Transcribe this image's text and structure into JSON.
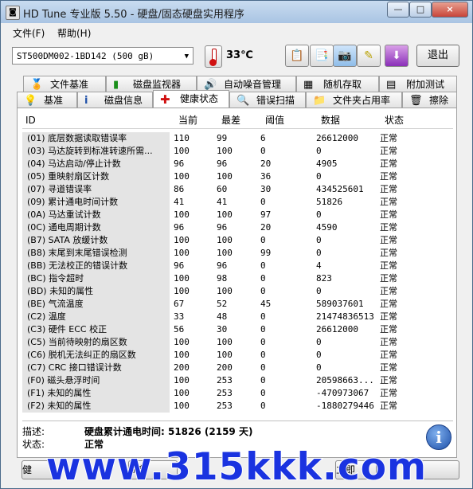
{
  "window": {
    "title": "HD Tune 专业版 5.50 - 硬盘/固态硬盘实用程序",
    "minimize": "—",
    "maximize": "□",
    "close": "×"
  },
  "menu": {
    "file": "文件(F)",
    "help": "帮助(H)"
  },
  "toolbar": {
    "drive": "ST500DM002-1BD142 (500 gB)",
    "temperature": "33℃",
    "exit": "退出",
    "icons": [
      "copy-icon",
      "copy-all-icon",
      "camera-icon",
      "settings-icon",
      "download-icon"
    ]
  },
  "tabs_top": [
    {
      "label": "文件基准",
      "icon": "file-benchmark-icon"
    },
    {
      "label": "磁盘监视器",
      "icon": "disk-monitor-icon"
    },
    {
      "label": "自动噪音管理",
      "icon": "speaker-icon"
    },
    {
      "label": "随机存取",
      "icon": "random-access-icon"
    },
    {
      "label": "附加测试",
      "icon": "extra-tests-icon"
    }
  ],
  "tabs_bottom": [
    {
      "label": "基准",
      "icon": "benchmark-icon"
    },
    {
      "label": "磁盘信息",
      "icon": "info-icon"
    },
    {
      "label": "健康状态",
      "icon": "health-cross-icon",
      "active": true
    },
    {
      "label": "错误扫描",
      "icon": "error-scan-icon"
    },
    {
      "label": "文件夹占用率",
      "icon": "folder-icon"
    },
    {
      "label": "擦除",
      "icon": "erase-icon"
    }
  ],
  "table": {
    "headers": [
      "ID",
      "当前",
      "最差",
      "阈值",
      "数据",
      "状态"
    ],
    "rows": [
      [
        "(01) 底层数据读取错误率",
        "110",
        "99",
        "6",
        "26612000",
        "正常"
      ],
      [
        "(03) 马达旋转到标准转速所需...",
        "100",
        "100",
        "0",
        "0",
        "正常"
      ],
      [
        "(04) 马达启动/停止计数",
        "96",
        "96",
        "20",
        "4905",
        "正常"
      ],
      [
        "(05) 重映射扇区计数",
        "100",
        "100",
        "36",
        "0",
        "正常"
      ],
      [
        "(07) 寻道错误率",
        "86",
        "60",
        "30",
        "434525601",
        "正常"
      ],
      [
        "(09) 累计通电时间计数",
        "41",
        "41",
        "0",
        "51826",
        "正常"
      ],
      [
        "(0A) 马达重试计数",
        "100",
        "100",
        "97",
        "0",
        "正常"
      ],
      [
        "(0C) 通电周期计数",
        "96",
        "96",
        "20",
        "4590",
        "正常"
      ],
      [
        "(B7) SATA 放缓计数",
        "100",
        "100",
        "0",
        "0",
        "正常"
      ],
      [
        "(B8) 末尾到末尾错误检测",
        "100",
        "100",
        "99",
        "0",
        "正常"
      ],
      [
        "(BB) 无法校正的错误计数",
        "96",
        "96",
        "0",
        "4",
        "正常"
      ],
      [
        "(BC) 指令超时",
        "100",
        "98",
        "0",
        "823",
        "正常"
      ],
      [
        "(BD) 未知的属性",
        "100",
        "100",
        "0",
        "0",
        "正常"
      ],
      [
        "(BE) 气流温度",
        "67",
        "52",
        "45",
        "589037601",
        "正常"
      ],
      [
        "(C2) 温度",
        "33",
        "48",
        "0",
        "21474836513",
        "正常"
      ],
      [
        "(C3) 硬件 ECC 校正",
        "56",
        "30",
        "0",
        "26612000",
        "正常"
      ],
      [
        "(C5) 当前待映射的扇区数",
        "100",
        "100",
        "0",
        "0",
        "正常"
      ],
      [
        "(C6) 脱机无法纠正的扇区数",
        "100",
        "100",
        "0",
        "0",
        "正常"
      ],
      [
        "(C7) CRC 接口错误计数",
        "200",
        "200",
        "0",
        "0",
        "正常"
      ],
      [
        "(F0) 磁头悬浮时间",
        "100",
        "253",
        "0",
        "20598663...",
        "正常"
      ],
      [
        "(F1) 未知的属性",
        "100",
        "253",
        "0",
        "-470973067",
        "正常"
      ],
      [
        "(F2) 未知的属性",
        "100",
        "253",
        "0",
        "-1880279446",
        "正常"
      ]
    ]
  },
  "details": {
    "desc_label": "描述:",
    "desc_value": "硬盘累计通电时间: 51826 (2159 天)",
    "status_label": "状态:",
    "status_value": "正常"
  },
  "bottom": {
    "btn1": "健",
    "btn2": "刷新",
    "btn3": "立即",
    "btn4": ""
  },
  "watermark": "www.315kkk.com",
  "colors": {
    "watermark": "#1a33e0",
    "id_cell_bg": "#e4e4e4",
    "health_icon": "#d01010"
  }
}
